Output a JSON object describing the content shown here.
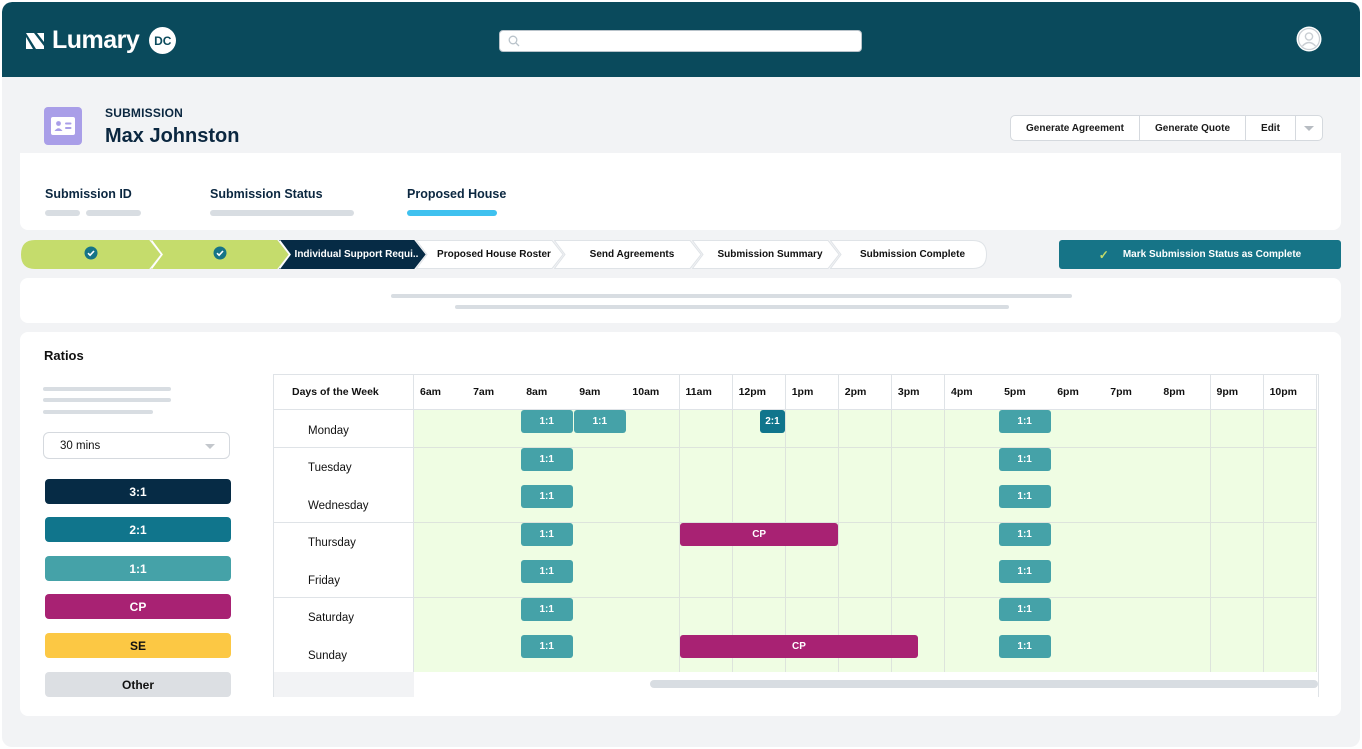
{
  "header": {
    "brand": "Lumary",
    "brand_badge": "DC",
    "search_placeholder": "",
    "icons": {
      "logo": "lumary-logo-icon",
      "search": "search-icon",
      "user": "user-avatar-icon"
    }
  },
  "record": {
    "type_label": "SUBMISSION",
    "name": "Max Johnston",
    "icon": "id-card-icon",
    "actions": [
      "Generate Agreement",
      "Generate Quote",
      "Edit"
    ]
  },
  "fields": [
    {
      "label": "Submission ID"
    },
    {
      "label": "Submission Status"
    },
    {
      "label": "Proposed House",
      "active": true
    }
  ],
  "stepper": {
    "steps": [
      {
        "label": "",
        "status": "complete"
      },
      {
        "label": "",
        "status": "complete"
      },
      {
        "label": "Individual Support Requi..",
        "status": "current"
      },
      {
        "label": "Proposed House Roster",
        "status": "upcoming"
      },
      {
        "label": "Send Agreements",
        "status": "upcoming"
      },
      {
        "label": "Submission Summary",
        "status": "upcoming"
      },
      {
        "label": "Submission Complete",
        "status": "upcoming"
      }
    ],
    "mark_complete_label": "Mark Submission Status as Complete"
  },
  "ratios": {
    "title": "Ratios",
    "interval": "30 mins",
    "legend": [
      {
        "label": "3:1",
        "color": "#062b45",
        "text_color": "#ffffff"
      },
      {
        "label": "2:1",
        "color": "#10758c",
        "text_color": "#ffffff"
      },
      {
        "label": "1:1",
        "color": "#45a2a8",
        "text_color": "#ffffff"
      },
      {
        "label": "CP",
        "color": "#a82273",
        "text_color": "#ffffff"
      },
      {
        "label": "SE",
        "color": "#fcc844",
        "text_color": "#111111"
      },
      {
        "label": "Other",
        "color": "#dcdfe3",
        "text_color": "#111111"
      }
    ]
  },
  "schedule": {
    "corner_label": "Days of the Week",
    "hours": [
      "6am",
      "7am",
      "8am",
      "9am",
      "10am",
      "11am",
      "12pm",
      "1pm",
      "2pm",
      "3pm",
      "4pm",
      "5pm",
      "6pm",
      "7pm",
      "8pm",
      "9pm",
      "10pm"
    ],
    "days": [
      "Monday",
      "Tuesday",
      "Wednesday",
      "Thursday",
      "Friday",
      "Saturday",
      "Sunday"
    ],
    "blocks": [
      {
        "day": "Monday",
        "start": 8,
        "end": 9,
        "type": "1:1"
      },
      {
        "day": "Monday",
        "start": 9,
        "end": 10,
        "type": "1:1"
      },
      {
        "day": "Monday",
        "start": 12.5,
        "end": 13,
        "type": "2:1"
      },
      {
        "day": "Monday",
        "start": 17,
        "end": 18,
        "type": "1:1"
      },
      {
        "day": "Tuesday",
        "start": 8,
        "end": 9,
        "type": "1:1"
      },
      {
        "day": "Tuesday",
        "start": 17,
        "end": 18,
        "type": "1:1"
      },
      {
        "day": "Wednesday",
        "start": 8,
        "end": 9,
        "type": "1:1"
      },
      {
        "day": "Wednesday",
        "start": 17,
        "end": 18,
        "type": "1:1"
      },
      {
        "day": "Thursday",
        "start": 8,
        "end": 9,
        "type": "1:1"
      },
      {
        "day": "Thursday",
        "start": 11,
        "end": 14,
        "type": "CP"
      },
      {
        "day": "Thursday",
        "start": 17,
        "end": 18,
        "type": "1:1"
      },
      {
        "day": "Friday",
        "start": 8,
        "end": 9,
        "type": "1:1"
      },
      {
        "day": "Friday",
        "start": 17,
        "end": 18,
        "type": "1:1"
      },
      {
        "day": "Saturday",
        "start": 8,
        "end": 9,
        "type": "1:1"
      },
      {
        "day": "Saturday",
        "start": 17,
        "end": 18,
        "type": "1:1"
      },
      {
        "day": "Sunday",
        "start": 8,
        "end": 9,
        "type": "1:1"
      },
      {
        "day": "Sunday",
        "start": 11,
        "end": 15.5,
        "type": "CP"
      },
      {
        "day": "Sunday",
        "start": 17,
        "end": 18,
        "type": "1:1"
      }
    ]
  },
  "colors": {
    "header_bg": "#0a4a5c",
    "accent_blue": "#3fc1ef",
    "step_complete": "#c5dc6c",
    "step_current": "#062b45",
    "check_circle": "#167487",
    "slot_bg": "#effde3"
  }
}
